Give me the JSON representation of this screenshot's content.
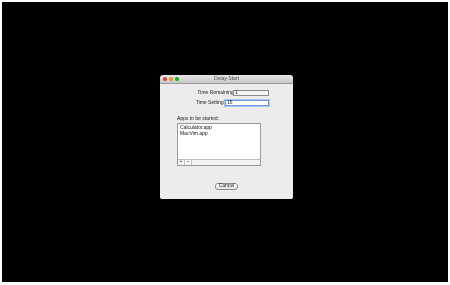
{
  "window": {
    "title": "Delay Start"
  },
  "form": {
    "time_remaining_label": "Time Remaining:",
    "time_remaining_value": "1",
    "time_setting_label": "Time Setting:",
    "time_setting_value": "15"
  },
  "apps": {
    "label": "Apps to be started:",
    "items": [
      "Calculator.app",
      "MacVim.app"
    ],
    "add_label": "+",
    "remove_label": "−"
  },
  "buttons": {
    "cancel_label": "Cancel"
  },
  "colors": {
    "screen_background": "#000000",
    "window_background": "#ececec",
    "close_light": "#e0443e",
    "minimize_light": "#dea123",
    "zoom_light": "#1aab29",
    "focus_ring": "#6f9ad8"
  }
}
